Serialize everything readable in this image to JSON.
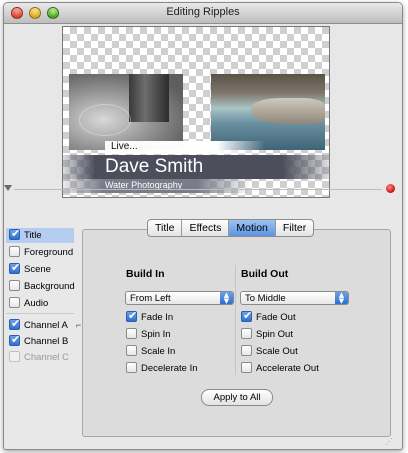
{
  "window": {
    "title": "Editing Ripples"
  },
  "preview": {
    "lower_third_small": "Live...",
    "lower_third_name": "Dave Smith",
    "lower_third_sub": "Water Photography"
  },
  "sidebar": {
    "items": [
      {
        "label": "Title",
        "checked": true,
        "selected": true
      },
      {
        "label": "Foreground",
        "checked": false
      },
      {
        "label": "Scene",
        "checked": true
      },
      {
        "label": "Background",
        "checked": false
      },
      {
        "label": "Audio",
        "checked": false
      },
      {
        "label": "Channel A",
        "checked": true
      },
      {
        "label": "Channel B",
        "checked": true
      },
      {
        "label": "Channel C",
        "checked": false,
        "disabled": true
      }
    ]
  },
  "tabs": [
    {
      "label": "Title"
    },
    {
      "label": "Effects"
    },
    {
      "label": "Motion",
      "selected": true
    },
    {
      "label": "Filter"
    }
  ],
  "build_in": {
    "header": "Build In",
    "popup_value": "From Left",
    "options": [
      {
        "label": "Fade In",
        "checked": true
      },
      {
        "label": "Spin In",
        "checked": false
      },
      {
        "label": "Scale In",
        "checked": false
      },
      {
        "label": "Decelerate In",
        "checked": false
      }
    ]
  },
  "build_out": {
    "header": "Build Out",
    "popup_value": "To Middle",
    "options": [
      {
        "label": "Fade Out",
        "checked": true
      },
      {
        "label": "Spin Out",
        "checked": false
      },
      {
        "label": "Scale Out",
        "checked": false
      },
      {
        "label": "Accelerate Out",
        "checked": false
      }
    ]
  },
  "apply_button": "Apply to All"
}
